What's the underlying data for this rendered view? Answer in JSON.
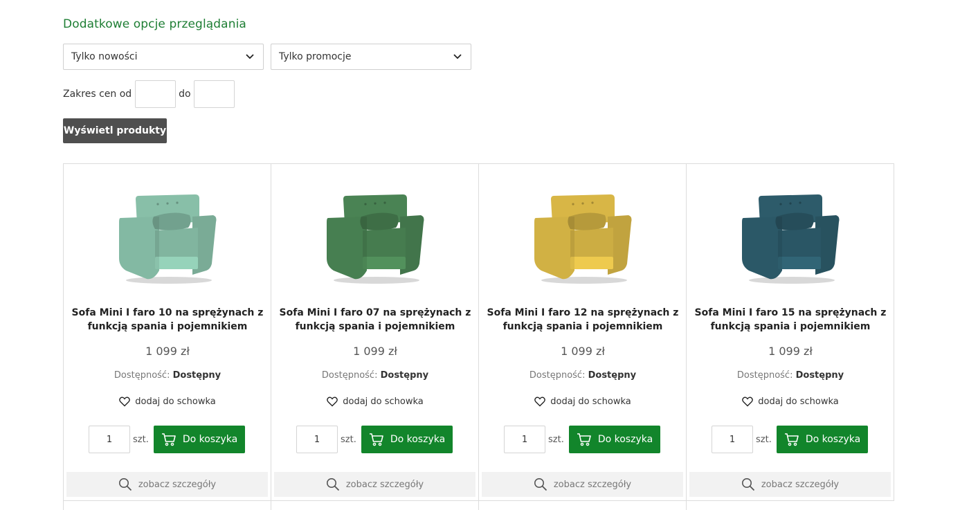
{
  "filters": {
    "heading": "Dodatkowe opcje przeglądania",
    "select_new": "Tylko nowości",
    "select_promo": "Tylko promocje",
    "price_label": "Zakres cen od",
    "price_to_label": "do",
    "show_button": "Wyświetl produkty"
  },
  "accent_color": "#12852b",
  "products": [
    {
      "title": "Sofa Mini I faro 10 na sprężynach z funkcją spania i pojemnikiem",
      "price": "1 099 zł",
      "availability_label": "Dostępność:",
      "availability_value": "Dostępny",
      "wishlist_label": "dodaj do schowka",
      "qty": "1",
      "unit": "szt.",
      "cart_label": "Do koszyka",
      "details_label": "zobacz szczegóły",
      "color": "#8fc9b1"
    },
    {
      "title": "Sofa Mini I faro 07 na sprężynach z funkcją spania i pojemnikiem",
      "price": "1 099 zł",
      "availability_label": "Dostępność:",
      "availability_value": "Dostępny",
      "wishlist_label": "dodaj do schowka",
      "qty": "1",
      "unit": "szt.",
      "cart_label": "Do koszyka",
      "details_label": "zobacz szczegóły",
      "color": "#4e8a58"
    },
    {
      "title": "Sofa Mini I faro 12 na sprężynach z funkcją spania i pojemnikiem",
      "price": "1 099 zł",
      "availability_label": "Dostępność:",
      "availability_value": "Dostępny",
      "wishlist_label": "dodaj do schowka",
      "qty": "1",
      "unit": "szt.",
      "cart_label": "Do koszyka",
      "details_label": "zobacz szczegóły",
      "color": "#e3c04a"
    },
    {
      "title": "Sofa Mini I faro 15 na sprężynach z funkcją spania i pojemnikiem",
      "price": "1 099 zł",
      "availability_label": "Dostępność:",
      "availability_value": "Dostępny",
      "wishlist_label": "dodaj do schowka",
      "qty": "1",
      "unit": "szt.",
      "cart_label": "Do koszyka",
      "details_label": "zobacz szczegóły",
      "color": "#2f6070"
    }
  ]
}
